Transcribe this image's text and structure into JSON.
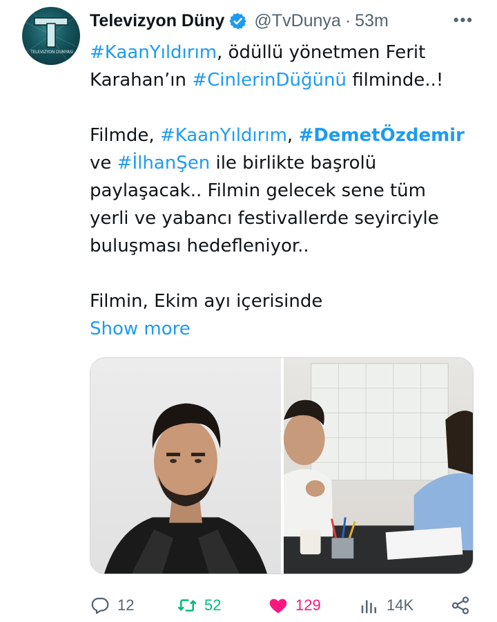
{
  "account": {
    "display_name": "Televizyon Düny",
    "handle": "@TvDunya",
    "separator": "·",
    "time": "53m",
    "avatar_text": "TELEVIZYON DUNYASI",
    "avatar_letter": "T"
  },
  "more_label": "•••",
  "tweet": {
    "line1": {
      "tag": "#KaanYıldırım",
      "text": ", ödüllü yönetmen Ferit"
    },
    "line2": {
      "text_a": "Karahan’ın ",
      "tag": "#CinlerinDüğünü",
      "text_b": " filminde..!"
    },
    "line3": {
      "text_a": "Filmde, ",
      "tag_a": "#KaanYıldırım",
      "text_b": ", ",
      "tag_b": "#DemetÖzdemir"
    },
    "line4": {
      "text_a": "ve ",
      "tag": "#İlhanŞen",
      "text_b": " ile birlikte başrolü"
    },
    "line5": "paylaşacak.. Filmin gelecek sene tüm",
    "line6": "yerli ve yabancı festivallerde seyirciyle",
    "line7": "buluşması hedefleniyor..",
    "line8": "Filmin, Ekim ayı içerisinde",
    "show_more": "Show more"
  },
  "actions": {
    "replies": "12",
    "reposts": "52",
    "likes": "129",
    "views": "14K"
  },
  "colors": {
    "link": "#1d9bf0",
    "muted": "#536471",
    "repost": "#00ba7c",
    "like": "#f91880",
    "verified": "#1d9bf0"
  },
  "icons": [
    "verified-badge-icon",
    "more-icon",
    "reply-icon",
    "repost-icon",
    "like-icon",
    "views-icon",
    "share-icon"
  ]
}
